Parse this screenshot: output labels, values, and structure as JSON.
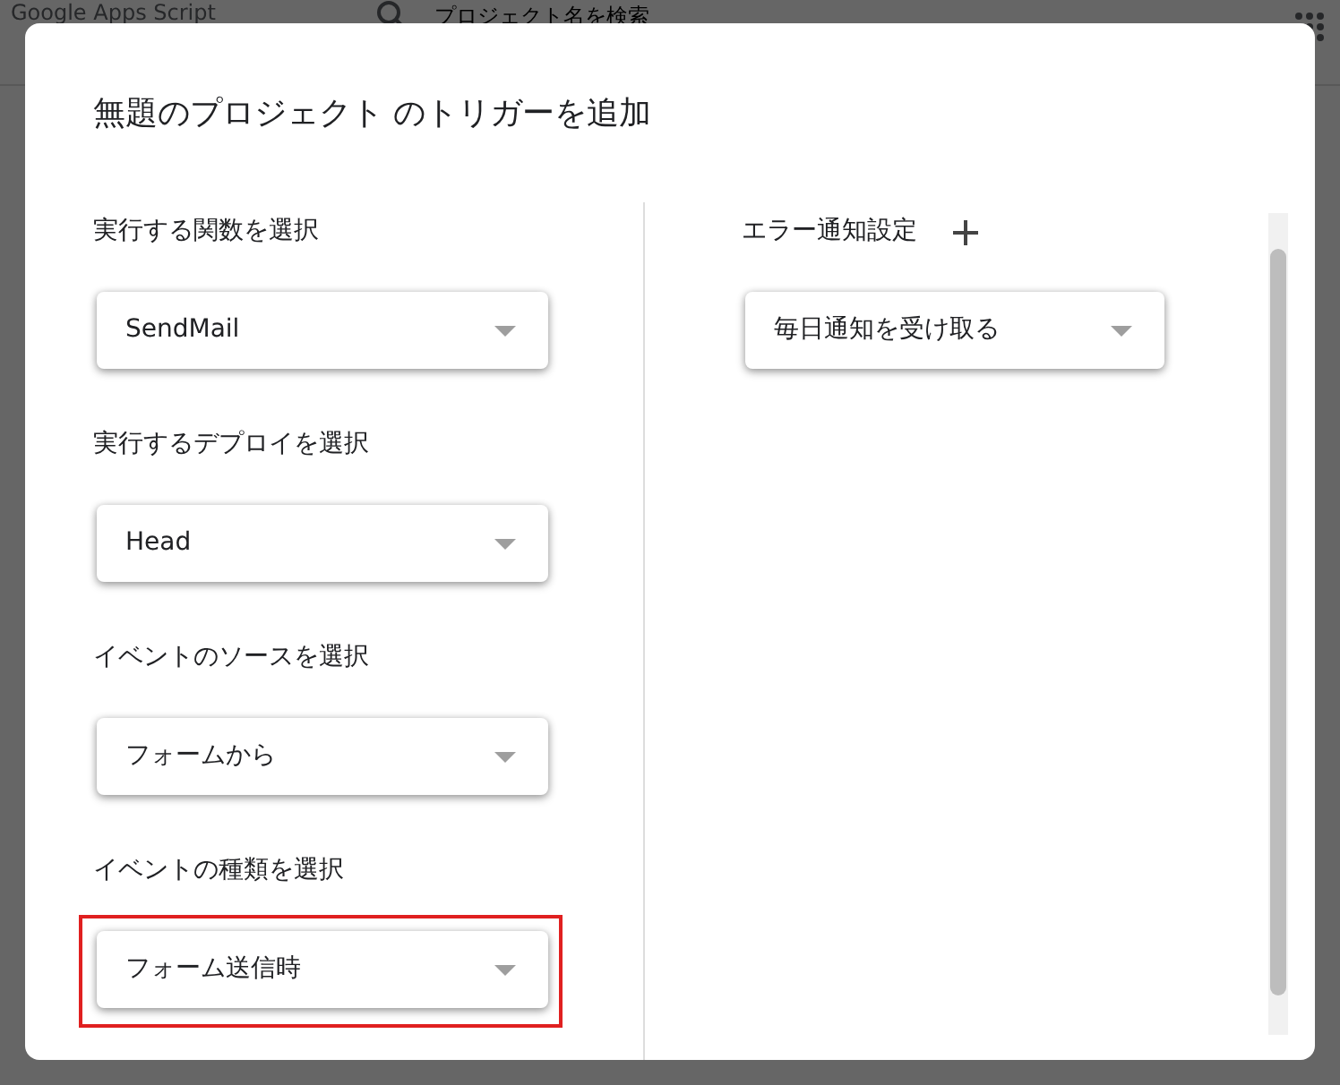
{
  "background": {
    "app_title": "Google Apps Script",
    "search_placeholder": "プロジェクト名を検索"
  },
  "dialog": {
    "title": "無題のプロジェクト のトリガーを追加",
    "fields": [
      {
        "label": "実行する関数を選択",
        "value": "SendMail",
        "highlighted": false
      },
      {
        "label": "実行するデプロイを選択",
        "value": "Head",
        "highlighted": false
      },
      {
        "label": "イベントのソースを選択",
        "value": "フォームから",
        "highlighted": false
      },
      {
        "label": "イベントの種類を選択",
        "value": "フォーム送信時",
        "highlighted": true
      }
    ],
    "error_notification": {
      "label": "エラー通知設定",
      "value": "毎日通知を受け取る"
    }
  }
}
